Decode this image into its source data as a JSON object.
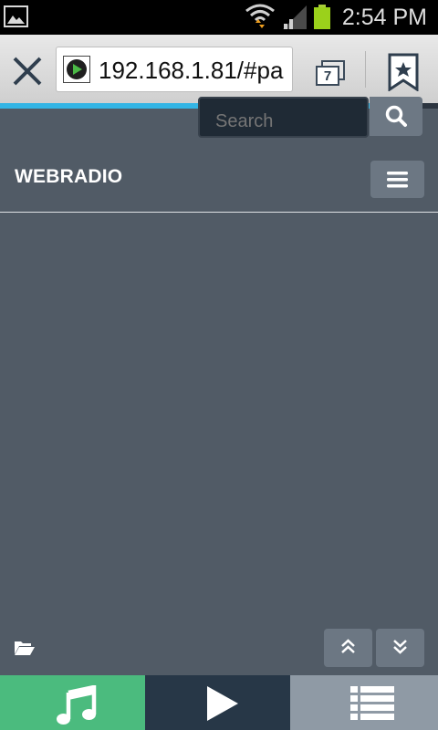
{
  "status_bar": {
    "time": "2:54 PM",
    "icons": [
      "gallery-icon",
      "wifi-icon",
      "signal-icon",
      "battery-icon"
    ]
  },
  "browser": {
    "url": "192.168.1.81/#pa",
    "tab_count": "7",
    "load_progress": 0.89,
    "icons": [
      "close-icon",
      "site-play-icon",
      "tabs-icon",
      "bookmark-icon"
    ]
  },
  "page": {
    "search": {
      "placeholder": "Search"
    },
    "header": {
      "title": "WEBRADIO"
    },
    "icons": [
      "search-icon",
      "hamburger-menu-icon",
      "folder-open-icon",
      "chevron-double-up-icon",
      "chevron-double-down-icon"
    ]
  },
  "bottom_nav": {
    "tabs": [
      {
        "name": "music",
        "icon": "music-note-icon",
        "color": "#4bbb7e"
      },
      {
        "name": "player",
        "icon": "play-icon",
        "color": "#273747"
      },
      {
        "name": "playlist",
        "icon": "list-icon",
        "color": "#8f9aa5"
      }
    ]
  },
  "colors": {
    "page_background": "#515b66",
    "accent_progress": "#33b5e5",
    "button": "#6c7783"
  }
}
